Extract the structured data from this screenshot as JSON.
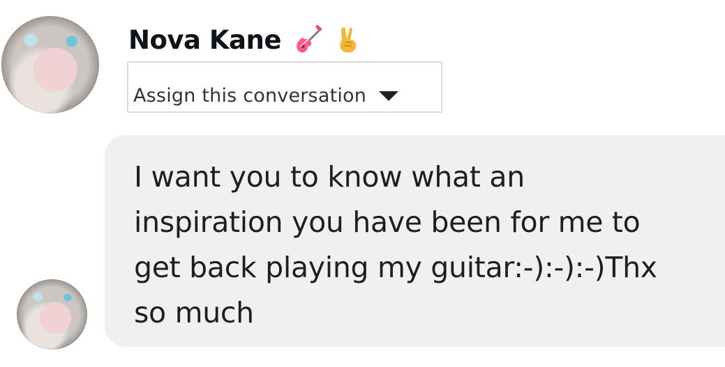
{
  "sender": {
    "name": "Nova Kane",
    "emojis": [
      "guitar-icon",
      "victory-hand-icon"
    ]
  },
  "assign": {
    "label": "Assign this conversation"
  },
  "message": {
    "text": "I want you to know what an\ninspiration you have been for me to\nget back playing my guitar:-):-):-)Thx\nso much"
  },
  "colors": {
    "bubble": "#f1f0f0",
    "text": "#1c1e21",
    "dropdown_border": "#d9dbde"
  }
}
